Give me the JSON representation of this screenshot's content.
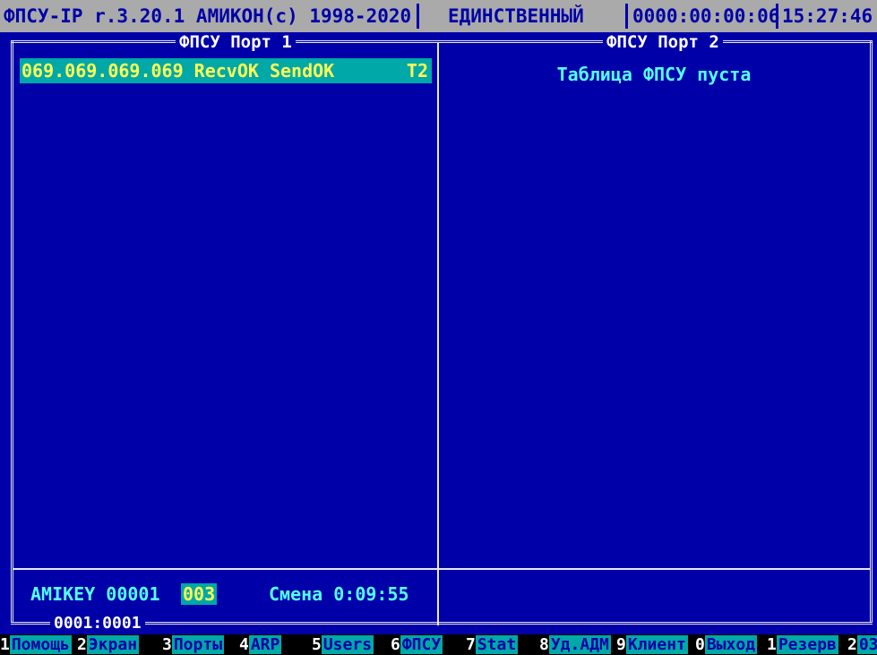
{
  "header": {
    "product": "ФПСУ-IP r.3.20.1 АМИКОН(с) 1998-2020",
    "mode": "ЕДИНСТВЕННЫЙ",
    "uptime": "0000:00:00:06",
    "clock": "15:27:46"
  },
  "panels": {
    "left": {
      "title": "ФПСУ Порт 1",
      "rows": [
        {
          "address": "069.069.069.069 RecvOK SendOK",
          "tag": "T2"
        }
      ]
    },
    "right": {
      "title": "ФПСУ Порт 2",
      "empty_message": "Таблица ФПСУ пуста"
    }
  },
  "status": {
    "key": "AMIKEY 00001",
    "code": "003",
    "shift": "Смена 0:09:55",
    "port_counter": "0001:0001"
  },
  "function_keys": [
    {
      "num": "1",
      "label": "Помощь"
    },
    {
      "num": "2",
      "label": "Экран"
    },
    {
      "num": "3",
      "label": "Порты"
    },
    {
      "num": "4",
      "label": "ARP"
    },
    {
      "num": "5",
      "label": "Users"
    },
    {
      "num": "6",
      "label": "ФПСУ"
    },
    {
      "num": "7",
      "label": "Stat"
    },
    {
      "num": "8",
      "label": "Уд.АДМ"
    },
    {
      "num": "9",
      "label": "Клиент"
    },
    {
      "num": "0",
      "label": "Выход"
    },
    {
      "num": "1",
      "label": "Резерв"
    },
    {
      "num": "2",
      "label": "03"
    }
  ],
  "colors": {
    "background": "#0000a8",
    "highlight": "#00a8a8",
    "text_yellow": "#ffff55",
    "text_cyan": "#55ffff",
    "header_bar": "#aaaaaa"
  }
}
